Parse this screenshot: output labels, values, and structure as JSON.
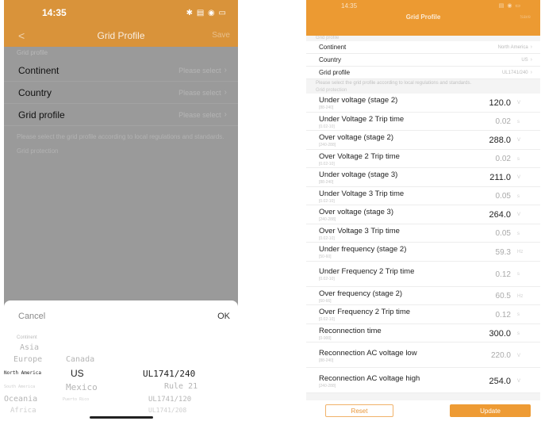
{
  "left": {
    "status": {
      "time": "14:35",
      "icons": "✱ ▤ ◉ ▭"
    },
    "nav": {
      "back": "<",
      "title": "Grid Profile",
      "action": "Save"
    },
    "section_label": "Grid profile",
    "rows": [
      {
        "label": "Continent",
        "value": "Please select"
      },
      {
        "label": "Country",
        "value": "Please select"
      },
      {
        "label": "Grid profile",
        "value": "Please select"
      }
    ],
    "note": "Please select the grid profile according to local regulations and standards.",
    "subhead": "Grid protection",
    "sheet": {
      "cancel": "Cancel",
      "ok": "OK",
      "col_head": "Continent",
      "continents": {
        "c1": "Asia",
        "c2": "Europe",
        "selected": "North America",
        "c4": "South America",
        "c5": "Oceania",
        "c6": "Africa"
      },
      "countries": {
        "c1": "Canada",
        "selected": "US",
        "c3": "Mexico",
        "c4": "Puerto Rico"
      },
      "profiles": {
        "selected": "UL1741/240",
        "c2": "Rule 21",
        "c3": "UL1741/120",
        "c4": "UL1741/208"
      }
    }
  },
  "right": {
    "status": {
      "time": "14:35",
      "icons": "▤ ◉ ▭"
    },
    "title": "Grid Profile",
    "action": "Save",
    "section1": "Grid profile",
    "top_rows": [
      {
        "label": "Continent",
        "value": "North America"
      },
      {
        "label": "Country",
        "value": "US"
      },
      {
        "label": "Grid profile",
        "value": "UL1741/240"
      }
    ],
    "note": "Please select the grid profile according to local regulations and standards.",
    "section2": "Grid protection",
    "params": [
      {
        "label": "Under voltage (stage 2)",
        "sub": "[88-240]",
        "value": "120.0",
        "unit": "V",
        "dim": false
      },
      {
        "label": "Under Voltage 2 Trip time",
        "sub": "[0.02-10]",
        "value": "0.02",
        "unit": "s",
        "dim": true
      },
      {
        "label": "Over voltage (stage 2)",
        "sub": "[240-288]",
        "value": "288.0",
        "unit": "V",
        "dim": false
      },
      {
        "label": "Over Voltage 2 Trip time",
        "sub": "[0.02-10]",
        "value": "0.02",
        "unit": "s",
        "dim": true
      },
      {
        "label": "Under voltage (stage 3)",
        "sub": "[88-240]",
        "value": "211.0",
        "unit": "V",
        "dim": false
      },
      {
        "label": "Under Voltage 3 Trip time",
        "sub": "[0.02-10]",
        "value": "0.05",
        "unit": "s",
        "dim": true
      },
      {
        "label": "Over voltage (stage 3)",
        "sub": "[240-288]",
        "value": "264.0",
        "unit": "V",
        "dim": false
      },
      {
        "label": "Over Voltage 3 Trip time",
        "sub": "[0.02-10]",
        "value": "0.05",
        "unit": "s",
        "dim": true
      },
      {
        "label": "Under frequency (stage 2)",
        "sub": "[50-60]",
        "value": "59.3",
        "unit": "Hz",
        "dim": true
      },
      {
        "label": "Under Frequency 2 Trip time",
        "sub": "[0.02-10]",
        "value": "0.12",
        "unit": "s",
        "dim": true
      },
      {
        "label": "Over frequency (stage 2)",
        "sub": "[60-66]",
        "value": "60.5",
        "unit": "Hz",
        "dim": true
      },
      {
        "label": "Over Frequency 2 Trip time",
        "sub": "[0.02-10]",
        "value": "0.12",
        "unit": "s",
        "dim": true
      },
      {
        "label": "Reconnection time",
        "sub": "[0-900]",
        "value": "300.0",
        "unit": "s",
        "dim": false
      },
      {
        "label": "Reconnection AC voltage low",
        "sub": "[88-240]",
        "value": "220.0",
        "unit": "V",
        "dim": true
      },
      {
        "label": "Reconnection AC voltage high",
        "sub": "[240-288]",
        "value": "254.0",
        "unit": "V",
        "dim": false
      }
    ],
    "reset": "Reset",
    "update": "Update"
  }
}
